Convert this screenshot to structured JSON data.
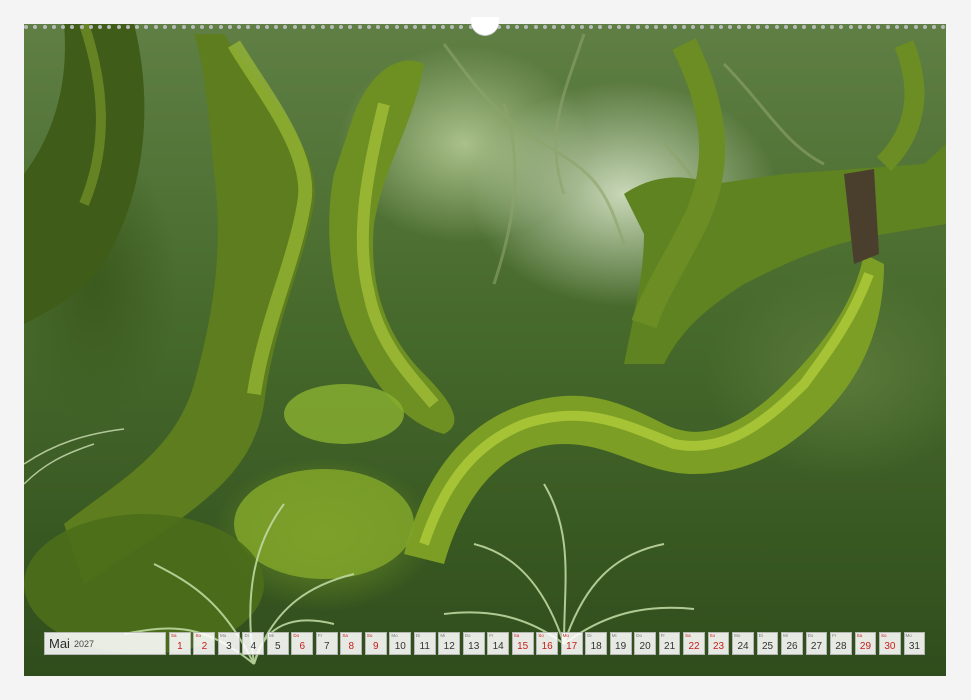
{
  "calendar": {
    "month": "Mai",
    "year": "2027",
    "days": [
      {
        "n": "1",
        "dow": "Sa",
        "red": true
      },
      {
        "n": "2",
        "dow": "So",
        "red": true
      },
      {
        "n": "3",
        "dow": "Mo",
        "red": false
      },
      {
        "n": "4",
        "dow": "Di",
        "red": false
      },
      {
        "n": "5",
        "dow": "Mi",
        "red": false
      },
      {
        "n": "6",
        "dow": "Do",
        "red": true
      },
      {
        "n": "7",
        "dow": "Fr",
        "red": false
      },
      {
        "n": "8",
        "dow": "Sa",
        "red": true
      },
      {
        "n": "9",
        "dow": "So",
        "red": true
      },
      {
        "n": "10",
        "dow": "Mo",
        "red": false
      },
      {
        "n": "11",
        "dow": "Di",
        "red": false
      },
      {
        "n": "12",
        "dow": "Mi",
        "red": false
      },
      {
        "n": "13",
        "dow": "Do",
        "red": false
      },
      {
        "n": "14",
        "dow": "Fr",
        "red": false
      },
      {
        "n": "15",
        "dow": "Sa",
        "red": true
      },
      {
        "n": "16",
        "dow": "So",
        "red": true
      },
      {
        "n": "17",
        "dow": "Mo",
        "red": true
      },
      {
        "n": "18",
        "dow": "Di",
        "red": false
      },
      {
        "n": "19",
        "dow": "Mi",
        "red": false
      },
      {
        "n": "20",
        "dow": "Do",
        "red": false
      },
      {
        "n": "21",
        "dow": "Fr",
        "red": false
      },
      {
        "n": "22",
        "dow": "Sa",
        "red": true
      },
      {
        "n": "23",
        "dow": "So",
        "red": true
      },
      {
        "n": "24",
        "dow": "Mo",
        "red": false
      },
      {
        "n": "25",
        "dow": "Di",
        "red": false
      },
      {
        "n": "26",
        "dow": "Mi",
        "red": false
      },
      {
        "n": "27",
        "dow": "Do",
        "red": false
      },
      {
        "n": "28",
        "dow": "Fr",
        "red": false
      },
      {
        "n": "29",
        "dow": "Sa",
        "red": true
      },
      {
        "n": "30",
        "dow": "So",
        "red": true
      },
      {
        "n": "31",
        "dow": "Mo",
        "red": false
      }
    ]
  },
  "colors": {
    "weekend_red": "#c81d1d",
    "moss_green": "#7a9a2a",
    "paper": "#f4f4f4"
  }
}
